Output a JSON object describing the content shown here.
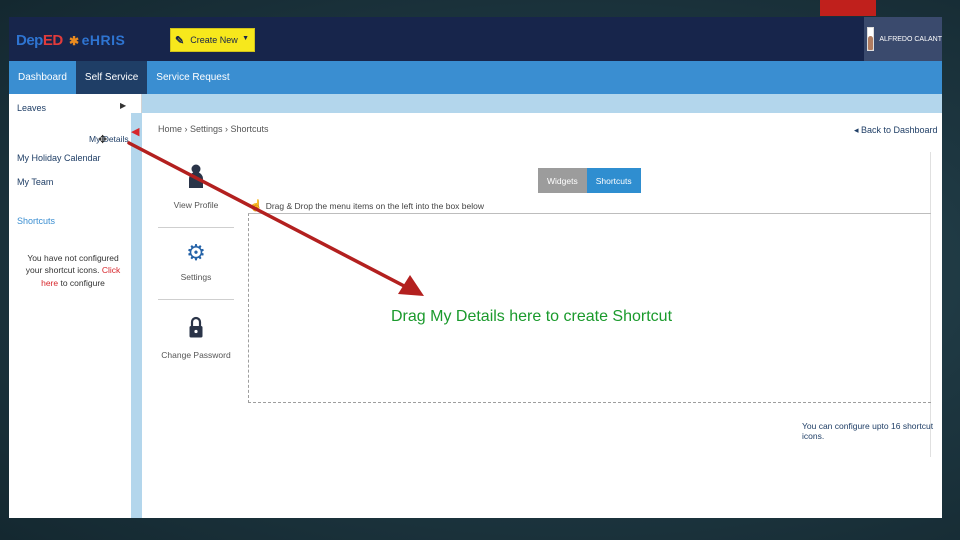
{
  "header": {
    "logo_deped_main": "Dep",
    "logo_deped_suffix": "ED",
    "logo_ehris": "eHRIS",
    "create_new_label": "Create New",
    "create_new_icon": "pen-icon",
    "user_name": "ALFREDO CALANT"
  },
  "nav": {
    "items": [
      {
        "label": "Dashboard",
        "active": false
      },
      {
        "label": "Self Service",
        "active": true
      },
      {
        "label": "Service Request",
        "active": false
      }
    ]
  },
  "sidebar": {
    "leaves_label": "Leaves",
    "my_details_label": "My Details",
    "holiday_label": "My Holiday Calendar",
    "team_label": "My Team",
    "shortcuts_heading": "Shortcuts",
    "note_text": "You have not configured your shortcut icons.",
    "note_link": "Click here",
    "note_suffix": "to configure"
  },
  "main": {
    "breadcrumb": "Home › Settings › Shortcuts",
    "back_link": "◂ Back to Dashboard",
    "menu": [
      {
        "label": "View Profile",
        "icon": "user-icon"
      },
      {
        "label": "Settings",
        "icon": "gears-icon"
      },
      {
        "label": "Change Password",
        "icon": "lock-icon"
      }
    ],
    "tabs": [
      {
        "label": "Widgets",
        "active": false
      },
      {
        "label": "Shortcuts",
        "active": true
      }
    ],
    "drop_hint": "Drag & Drop the menu items on the left into the box below",
    "limit_note": "You can configure upto 16 shortcut icons."
  },
  "annotation": {
    "text": "Drag My Details here to create Shortcut",
    "text_color": "#1a9a2c",
    "arrow_color": "#b3201f"
  },
  "colors": {
    "header_bg": "#17254b",
    "nav_bg": "#3a8ed1",
    "nav_active": "#1f3e66",
    "create_btn": "#f7e81c",
    "tab_active": "#2f8ed0"
  }
}
